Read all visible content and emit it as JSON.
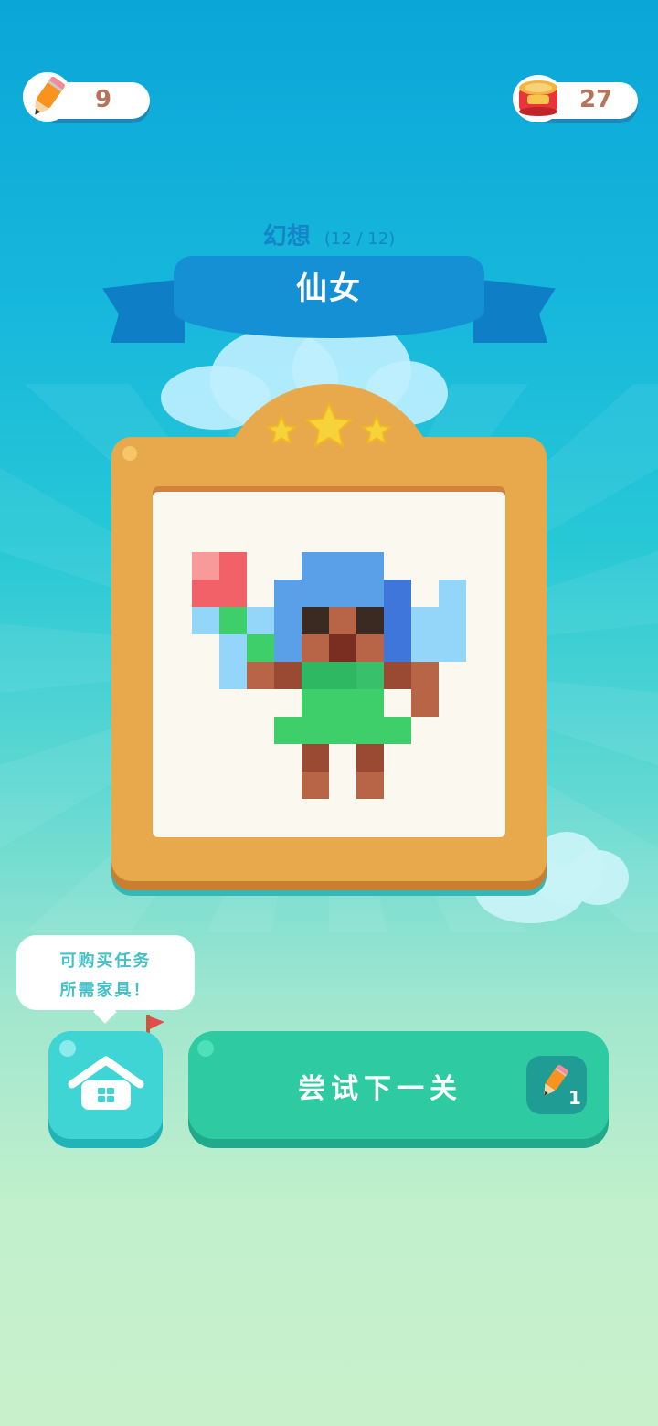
{
  "hud": {
    "pencil_count": "9",
    "coin_count": "27",
    "pencil_icon": "pencil-icon",
    "can_icon": "food-can-icon"
  },
  "level": {
    "category": "幻想",
    "progress": "(12 / 12)",
    "title": "仙女",
    "stars_earned": 3,
    "stars_total": 3
  },
  "tip": {
    "line1": "可购买任务",
    "line2": "所需家具！"
  },
  "buttons": {
    "home_icon": "house-icon",
    "next_label": "尝试下一关",
    "next_cost": "1"
  },
  "colors": {
    "accent": "#2ecaa1",
    "frame": "#e8a94c",
    "banner": "#1590d4"
  }
}
